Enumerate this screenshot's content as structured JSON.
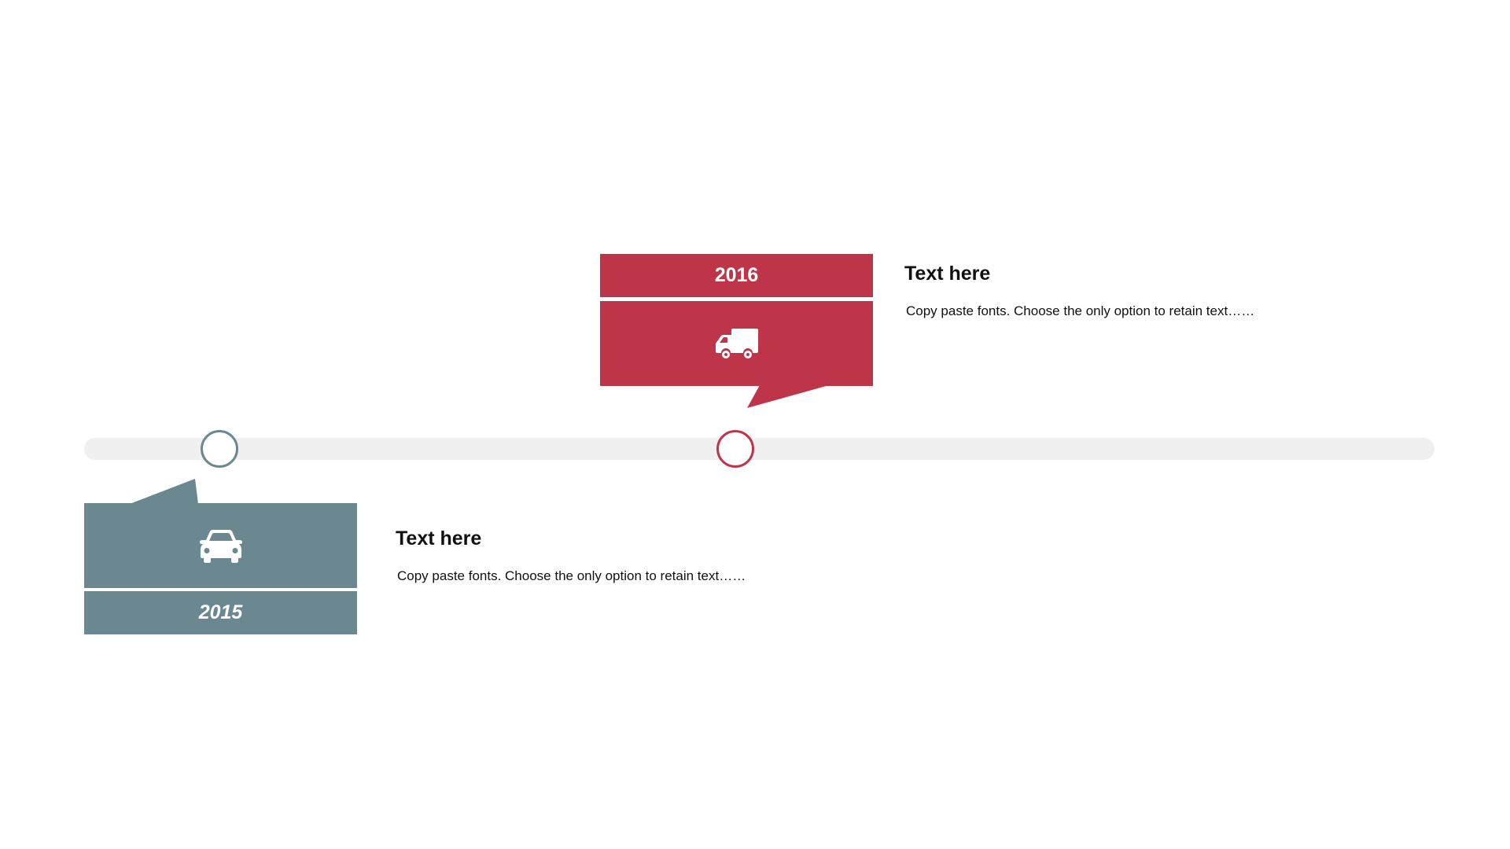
{
  "colors": {
    "track": "#f0f0f0",
    "milestone_2015": "#6b8890",
    "milestone_2016": "#be3549",
    "icon": "#ffffff",
    "text": "#111111"
  },
  "milestones": [
    {
      "year": "2015",
      "icon": "car-icon",
      "heading": "Text here",
      "body": "Copy paste fonts. Choose the only option to retain text……"
    },
    {
      "year": "2016",
      "icon": "truck-icon",
      "heading": "Text here",
      "body": "Copy paste fonts. Choose the only option to retain text……"
    }
  ]
}
